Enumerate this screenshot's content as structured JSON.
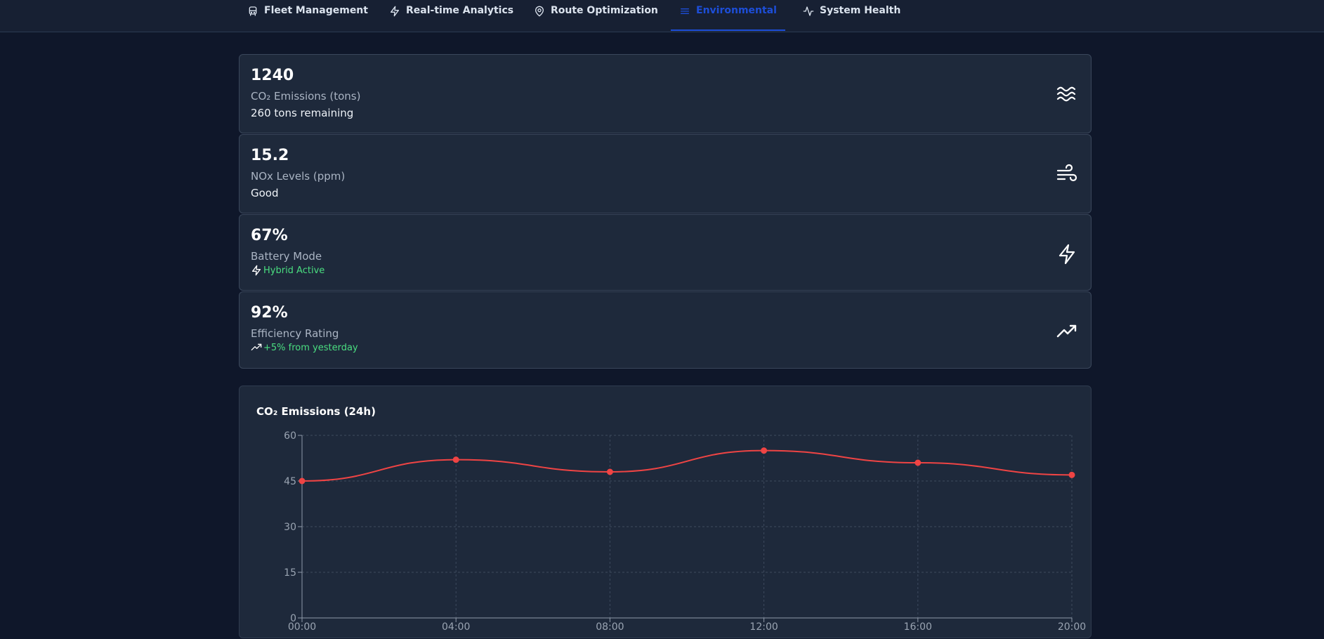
{
  "nav": {
    "tabs": [
      {
        "label": "Fleet Management",
        "icon": "bus-icon",
        "active": false
      },
      {
        "label": "Real-time Analytics",
        "icon": "lightning-icon",
        "active": false
      },
      {
        "label": "Route Optimization",
        "icon": "map-pin-icon",
        "active": false
      },
      {
        "label": "Environmental",
        "icon": "list-icon",
        "active": true
      },
      {
        "label": "System Health",
        "icon": "activity-icon",
        "active": false
      }
    ]
  },
  "metrics": [
    {
      "value": "1240",
      "label": "CO₂ Emissions (tons)",
      "sub": "260 tons remaining",
      "icon": "waves-icon"
    },
    {
      "value": "15.2",
      "label": "NOx Levels (ppm)",
      "sub": "Good",
      "icon": "wind-icon"
    },
    {
      "value": "67%",
      "label": "Battery Mode",
      "sub": "Hybrid Active",
      "sub_icon": "lightning-icon",
      "icon": "lightning-icon"
    },
    {
      "value": "92%",
      "label": "Efficiency Rating",
      "sub": "+5% from yesterday",
      "sub_icon": "trending-up-icon",
      "icon": "trending-up-icon"
    }
  ],
  "colors": {
    "accent": "#1d4ed8",
    "positive": "#4ade80",
    "series": "#ef4444"
  },
  "chart_data": {
    "type": "line",
    "title": "CO₂ Emissions (24h)",
    "categories": [
      "00:00",
      "04:00",
      "08:00",
      "12:00",
      "16:00",
      "20:00"
    ],
    "series": [
      {
        "values": [
          45,
          52,
          48,
          55,
          51,
          47
        ]
      }
    ],
    "ylim": [
      0,
      60
    ],
    "yticks": [
      0,
      15,
      30,
      45,
      60
    ],
    "grid": true,
    "xlabel": "",
    "ylabel": ""
  }
}
